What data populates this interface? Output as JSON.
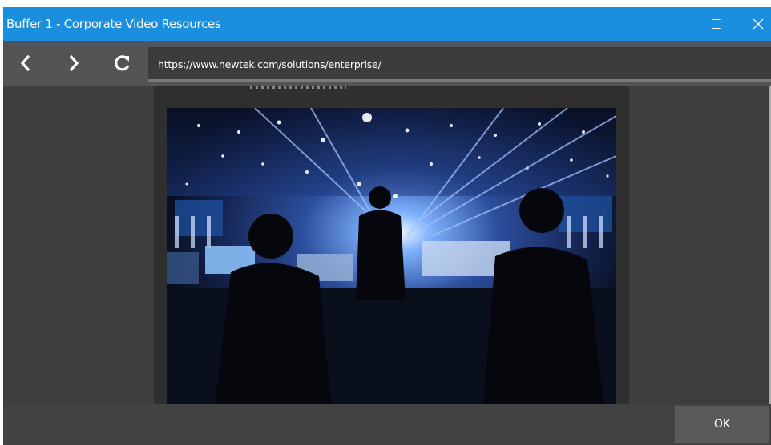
{
  "window": {
    "title": "Buffer 1 - Corporate Video Resources",
    "maximize_icon": "maximize-icon",
    "close_icon": "close-icon"
  },
  "nav": {
    "back_icon": "chevron-left-icon",
    "forward_icon": "chevron-right-icon",
    "reload_icon": "reload-icon",
    "url": "https://www.newtek.com/solutions/enterprise/"
  },
  "footer": {
    "ok_label": "OK"
  },
  "colors": {
    "titlebar": "#1a8fe0",
    "navbar": "#545454",
    "content_bg": "#3e3e3e",
    "ok_button": "#5a5a5a"
  }
}
